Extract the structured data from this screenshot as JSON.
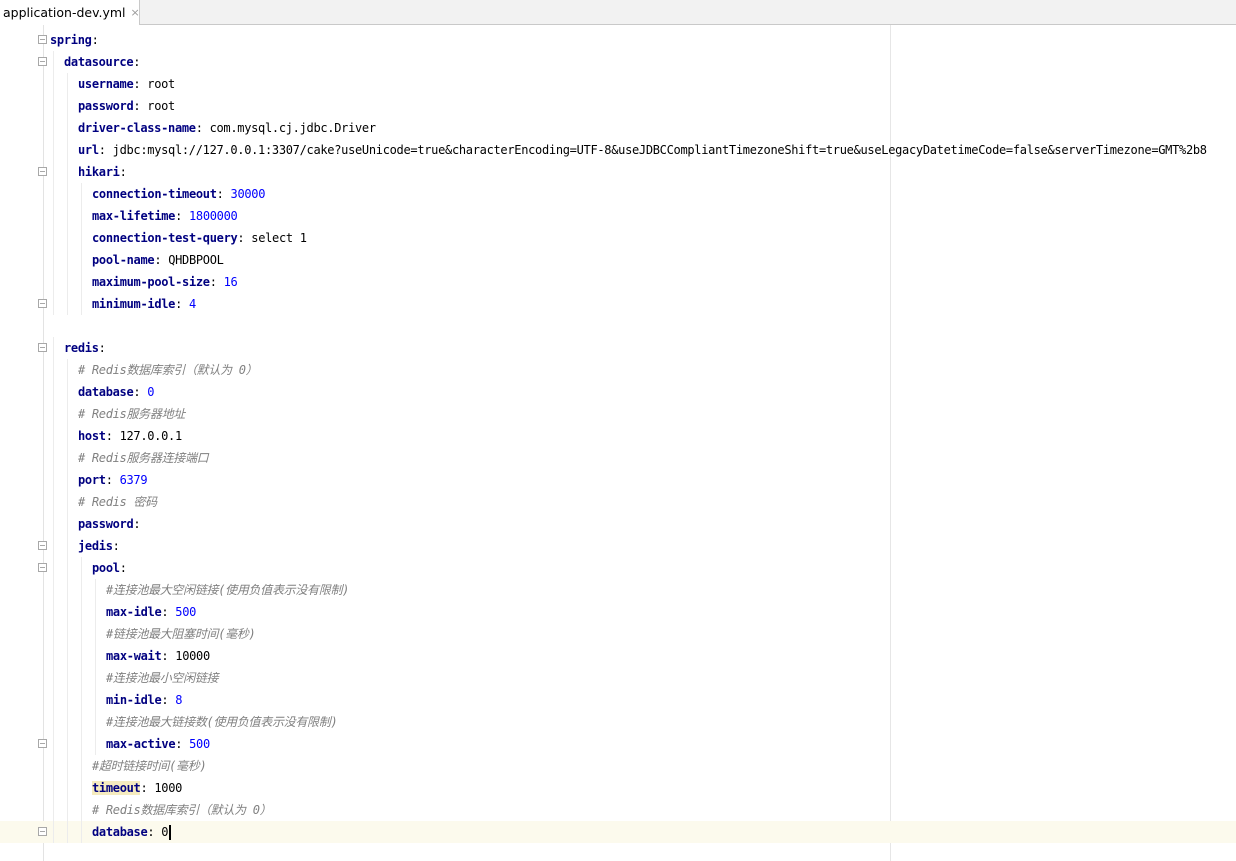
{
  "editor_tab": {
    "file_name": "application-dev.yml",
    "close_glyph": "×"
  },
  "colors": {
    "key": "#000080",
    "number": "#0000ff",
    "comment": "#808080",
    "current_line": "#fcfaed"
  },
  "lines": [
    {
      "indent": 0,
      "fold": "open",
      "key": "spring",
      "sep": ":"
    },
    {
      "indent": 1,
      "fold": "open",
      "key": "datasource",
      "sep": ":"
    },
    {
      "indent": 2,
      "key": "username",
      "sep": ": ",
      "value": "root",
      "vtype": "str"
    },
    {
      "indent": 2,
      "key": "password",
      "sep": ": ",
      "value": "root",
      "vtype": "str"
    },
    {
      "indent": 2,
      "key": "driver-class-name",
      "sep": ": ",
      "value": "com.mysql.cj.jdbc.Driver",
      "vtype": "str"
    },
    {
      "indent": 2,
      "key": "url",
      "sep": ": ",
      "value": "jdbc:mysql://127.0.0.1:3307/cake?useUnicode=true&characterEncoding=UTF-8&useJDBCCompliantTimezoneShift=true&useLegacyDatetimeCode=false&serverTimezone=GMT%2b8",
      "vtype": "str"
    },
    {
      "indent": 2,
      "fold": "open",
      "key": "hikari",
      "sep": ":"
    },
    {
      "indent": 3,
      "key": "connection-timeout",
      "sep": ": ",
      "value": "30000",
      "vtype": "num"
    },
    {
      "indent": 3,
      "key": "max-lifetime",
      "sep": ": ",
      "value": "1800000",
      "vtype": "num"
    },
    {
      "indent": 3,
      "key": "connection-test-query",
      "sep": ": ",
      "value": "select 1",
      "vtype": "str"
    },
    {
      "indent": 3,
      "key": "pool-name",
      "sep": ": ",
      "value": "QHDBPOOL",
      "vtype": "str"
    },
    {
      "indent": 3,
      "key": "maximum-pool-size",
      "sep": ": ",
      "value": "16",
      "vtype": "num"
    },
    {
      "indent": 3,
      "fold": "end",
      "key": "minimum-idle",
      "sep": ": ",
      "value": "4",
      "vtype": "num"
    },
    {
      "indent": 0,
      "blank": true
    },
    {
      "indent": 1,
      "fold": "open",
      "key": "redis",
      "sep": ":"
    },
    {
      "indent": 2,
      "comment": "# Redis数据库索引（默认为 0）"
    },
    {
      "indent": 2,
      "key": "database",
      "sep": ": ",
      "value": "0",
      "vtype": "num"
    },
    {
      "indent": 2,
      "comment": "# Redis服务器地址"
    },
    {
      "indent": 2,
      "key": "host",
      "sep": ": ",
      "value": "127.0.0.1",
      "vtype": "str"
    },
    {
      "indent": 2,
      "comment": "# Redis服务器连接端口"
    },
    {
      "indent": 2,
      "key": "port",
      "sep": ": ",
      "value": "6379",
      "vtype": "num"
    },
    {
      "indent": 2,
      "comment": "# Redis 密码"
    },
    {
      "indent": 2,
      "key": "password",
      "sep": ":"
    },
    {
      "indent": 2,
      "fold": "open",
      "key": "jedis",
      "sep": ":"
    },
    {
      "indent": 3,
      "fold": "open",
      "key": "pool",
      "sep": ":"
    },
    {
      "indent": 4,
      "comment": "#连接池最大空闲链接(使用负值表示没有限制)"
    },
    {
      "indent": 4,
      "key": "max-idle",
      "sep": ": ",
      "value": "500",
      "vtype": "num"
    },
    {
      "indent": 4,
      "comment": "#链接池最大阻塞时间(毫秒)"
    },
    {
      "indent": 4,
      "key": "max-wait",
      "sep": ": ",
      "value": "10000",
      "vtype": "str"
    },
    {
      "indent": 4,
      "comment": "#连接池最小空闲链接"
    },
    {
      "indent": 4,
      "key": "min-idle",
      "sep": ": ",
      "value": "8",
      "vtype": "num"
    },
    {
      "indent": 4,
      "comment": "#连接池最大链接数(使用负值表示没有限制)"
    },
    {
      "indent": 4,
      "fold": "end",
      "key": "max-active",
      "sep": ": ",
      "value": "500",
      "vtype": "num"
    },
    {
      "indent": 3,
      "comment": "#超时链接时间(毫秒)"
    },
    {
      "indent": 3,
      "key": "timeout",
      "sep": ": ",
      "value": "1000",
      "vtype": "str",
      "highlight": true
    },
    {
      "indent": 3,
      "comment": "# Redis数据库索引（默认为 0）"
    },
    {
      "indent": 3,
      "fold": "end",
      "key": "database",
      "sep": ": ",
      "value": "0",
      "vtype": "str",
      "current": true,
      "caret": true
    }
  ]
}
